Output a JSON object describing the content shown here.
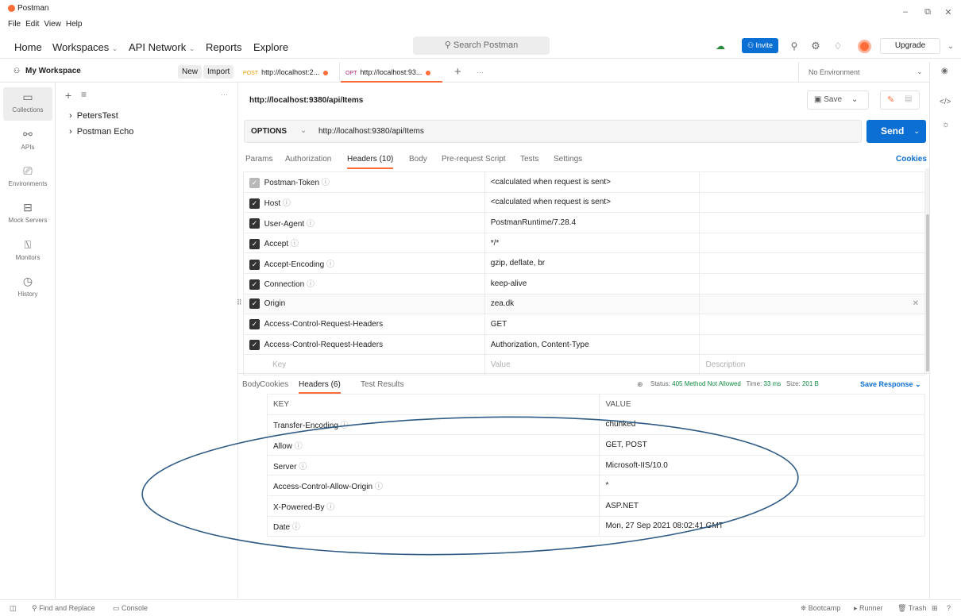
{
  "app": {
    "title": "Postman",
    "menu": [
      "File",
      "Edit",
      "View",
      "Help"
    ]
  },
  "window_controls": {
    "minimize": "–",
    "restore": "⧉",
    "close": "✕"
  },
  "nav": {
    "home": "Home",
    "workspaces": "Workspaces",
    "api_network": "API Network",
    "reports": "Reports",
    "explore": "Explore"
  },
  "search": {
    "placeholder": "Search Postman"
  },
  "header_right": {
    "invite": "Invite",
    "upgrade": "Upgrade"
  },
  "workspace": {
    "name": "My Workspace",
    "new_label": "New",
    "import_label": "Import"
  },
  "rail": [
    {
      "label": "Collections",
      "icon": "collections-icon"
    },
    {
      "label": "APIs",
      "icon": "apis-icon"
    },
    {
      "label": "Environments",
      "icon": "environments-icon"
    },
    {
      "label": "Mock Servers",
      "icon": "mock-servers-icon"
    },
    {
      "label": "Monitors",
      "icon": "monitors-icon"
    },
    {
      "label": "History",
      "icon": "history-icon"
    }
  ],
  "collections": [
    {
      "name": "PetersTest"
    },
    {
      "name": "Postman Echo"
    }
  ],
  "tabs": [
    {
      "method": "POST",
      "label": "http://localhost:2..."
    },
    {
      "method": "OPT",
      "label": "http://localhost:93..."
    }
  ],
  "environment": {
    "selected": "No Environment"
  },
  "request": {
    "name": "http://localhost:9380/api/Items",
    "save_label": "Save",
    "method": "OPTIONS",
    "url": "http://localhost:9380/api/Items",
    "send_label": "Send",
    "cookies_label": "Cookies"
  },
  "request_tabs": [
    "Params",
    "Authorization",
    "Headers (10)",
    "Body",
    "Pre-request Script",
    "Tests",
    "Settings"
  ],
  "request_headers": [
    {
      "key": "Postman-Token",
      "value": "<calculated when request is sent>",
      "disabled": true,
      "info": true
    },
    {
      "key": "Host",
      "value": "<calculated when request is sent>",
      "info": true
    },
    {
      "key": "User-Agent",
      "value": "PostmanRuntime/7.28.4",
      "info": true
    },
    {
      "key": "Accept",
      "value": "*/*",
      "info": true
    },
    {
      "key": "Accept-Encoding",
      "value": "gzip, deflate, br",
      "info": true
    },
    {
      "key": "Connection",
      "value": "keep-alive",
      "info": true
    },
    {
      "key": "Origin",
      "value": "zea.dk",
      "info": false,
      "hover": true
    },
    {
      "key": "Access-Control-Request-Headers",
      "value": "GET",
      "info": false
    },
    {
      "key": "Access-Control-Request-Headers",
      "value": "Authorization, Content-Type",
      "info": false
    }
  ],
  "new_header_placeholder": {
    "key": "Key",
    "value": "Value",
    "description": "Description"
  },
  "response_tabs": [
    "Body",
    "Cookies",
    "Headers (6)",
    "Test Results"
  ],
  "response_status": {
    "status_label": "Status:",
    "status_value": "405 Method Not Allowed",
    "time_label": "Time:",
    "time_value": "33 ms",
    "size_label": "Size:",
    "size_value": "201 B",
    "save_response": "Save Response"
  },
  "response_headers_columns": {
    "key": "KEY",
    "value": "VALUE"
  },
  "response_headers": [
    {
      "key": "Transfer-Encoding",
      "value": "chunked"
    },
    {
      "key": "Allow",
      "value": "GET, POST"
    },
    {
      "key": "Server",
      "value": "Microsoft-IIS/10.0"
    },
    {
      "key": "Access-Control-Allow-Origin",
      "value": "*"
    },
    {
      "key": "X-Powered-By",
      "value": "ASP.NET"
    },
    {
      "key": "Date",
      "value": "Mon, 27 Sep 2021 08:02:41 GMT"
    }
  ],
  "statusbar": {
    "find_replace": "Find and Replace",
    "console": "Console",
    "bootcamp": "Bootcamp",
    "runner": "Runner",
    "trash": "Trash"
  },
  "colors": {
    "accent": "#ff6c37",
    "send": "#0c6fd4",
    "link": "#0c6fd4",
    "status_ok": "#0c8a3f",
    "annotation": "#2e5a85"
  }
}
